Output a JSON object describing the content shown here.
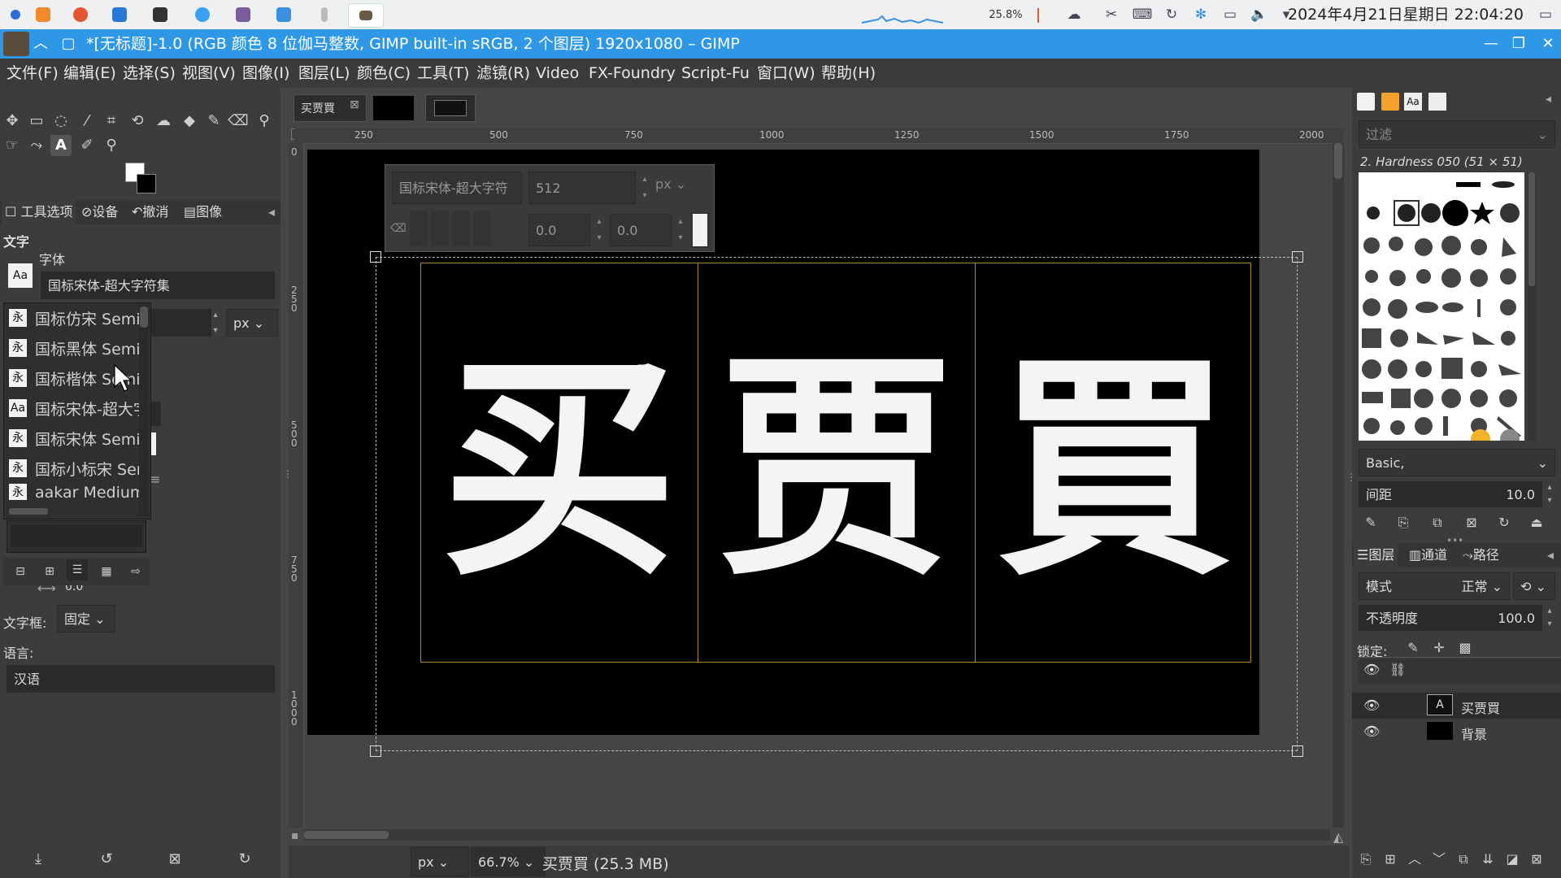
{
  "taskbar": {
    "zoom_indicator": "25.8%",
    "clock": "2024年4月21日星期日 22:04:20"
  },
  "window": {
    "title": "*[无标题]-1.0 (RGB 颜色 8 位伽马整数, GIMP built-in sRGB, 2 个图层) 1920x1080 – GIMP",
    "minimize": "—",
    "maximize": "❐",
    "close": "✕"
  },
  "menu": [
    "文件(F)",
    "编辑(E)",
    "选择(S)",
    "视图(V)",
    "图像(I)",
    "图层(L)",
    "颜色(C)",
    "工具(T)",
    "滤镜(R)",
    "Video",
    "FX-Foundry",
    "Script-Fu",
    "窗口(W)",
    "帮助(H)"
  ],
  "left_dock": {
    "tabs": [
      "工具选项",
      "设备",
      "撤消",
      "图像"
    ],
    "section_title": "文字",
    "font_label": "字体",
    "font_value": "国标宋体-超大字符集",
    "size_unit": "px",
    "justify_value": "0.0",
    "textbox_label": "文字框:",
    "textbox_value": "固定",
    "language_label": "语言:",
    "language_value": "汉语",
    "font_list": [
      {
        "glyph": "永",
        "name": "国标仿宋 Semi"
      },
      {
        "glyph": "永",
        "name": "国标黑体 Semi"
      },
      {
        "glyph": "永",
        "name": "国标楷体 Semi"
      },
      {
        "glyph": "Aa",
        "name": "国标宋体-超大字"
      },
      {
        "glyph": "永",
        "name": "国标宋体 Semi"
      },
      {
        "glyph": "永",
        "name": "国标小标宋 Sem"
      },
      {
        "glyph": "永",
        "name": "aakar Medium"
      }
    ]
  },
  "canvas": {
    "image_tab_label": "买贾買",
    "ruler_top": [
      "250",
      "500",
      "750",
      "1000",
      "1250",
      "1500",
      "1750",
      "2000"
    ],
    "ruler_left": [
      "0",
      "250",
      "500",
      "750",
      "1000"
    ],
    "glyphs": [
      "买",
      "贾",
      "買"
    ],
    "text_ctl": {
      "font": "国标宋体-超大字符",
      "size": "512",
      "unit": "px",
      "baseline": "0.0",
      "kerning": "0.0"
    }
  },
  "statusbar": {
    "unit": "px",
    "zoom": "66.7%",
    "info": "买贾買 (25.3 MB)"
  },
  "right_dock": {
    "filter_placeholder": "过滤",
    "brush_name": "2. Hardness 050 (51 × 51)",
    "preset": "Basic,",
    "spacing_label": "间距",
    "spacing_value": "10.0",
    "tabs": [
      "图层",
      "通道",
      "路径"
    ],
    "mode_label": "模式",
    "mode_value": "正常",
    "opacity_label": "不透明度",
    "opacity_value": "100.0",
    "lock_label": "锁定:",
    "layers": [
      {
        "name": "买贾買",
        "type": "text"
      },
      {
        "name": "背景",
        "type": "fill"
      }
    ]
  }
}
